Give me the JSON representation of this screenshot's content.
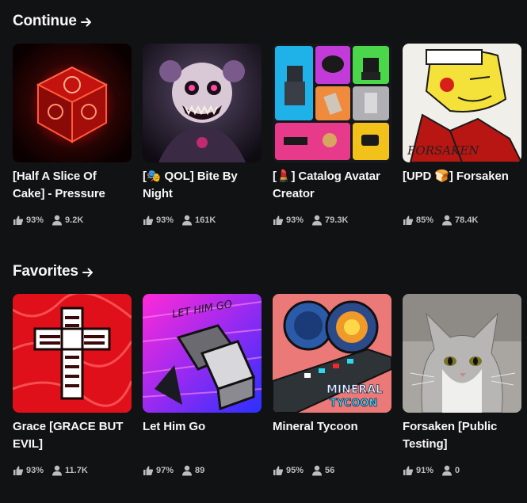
{
  "sections": [
    {
      "title": "Continue",
      "games": [
        {
          "title": "[Half A Slice Of Cake] - Pressure",
          "rating": "93%",
          "players": "9.2K"
        },
        {
          "title": "[🎭 QOL] Bite By Night",
          "rating": "93%",
          "players": "161K"
        },
        {
          "title": "[💄] Catalog Avatar Creator",
          "rating": "93%",
          "players": "79.3K"
        },
        {
          "title": "[UPD 🍞] Forsaken",
          "rating": "85%",
          "players": "78.4K"
        }
      ]
    },
    {
      "title": "Favorites",
      "games": [
        {
          "title": "Grace [GRACE BUT EVIL]",
          "rating": "93%",
          "players": "11.7K"
        },
        {
          "title": "Let Him Go",
          "rating": "97%",
          "players": "89"
        },
        {
          "title": "Mineral Tycoon",
          "rating": "95%",
          "players": "56"
        },
        {
          "title": "Forsaken [Public Testing]",
          "rating": "91%",
          "players": "0"
        }
      ]
    }
  ],
  "thumbnail_text": {
    "forsaken": "FORSAKEN",
    "let_him_go": "LET HIM GO",
    "mineral_1": "MINERAL",
    "mineral_2": "TYCOON"
  },
  "icons": {
    "section_arrow": "arrow-right-icon",
    "rating": "thumbs-up-icon",
    "players": "person-icon"
  },
  "colors": {
    "background": "#111214",
    "text": "#f7f7f8",
    "stat_text": "#bdbec0"
  }
}
